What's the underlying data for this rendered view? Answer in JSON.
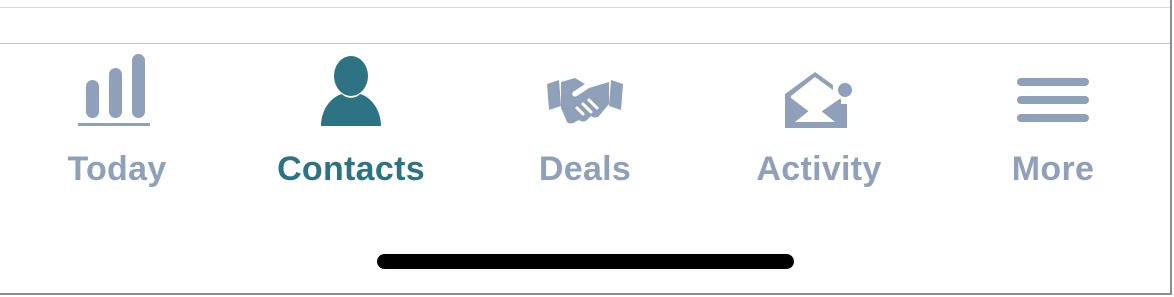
{
  "tabs": [
    {
      "label": "Today",
      "icon": "bar-chart-icon",
      "active": false
    },
    {
      "label": "Contacts",
      "icon": "person-icon",
      "active": true
    },
    {
      "label": "Deals",
      "icon": "handshake-icon",
      "active": false
    },
    {
      "label": "Activity",
      "icon": "envelope-icon",
      "active": false
    },
    {
      "label": "More",
      "icon": "hamburger-menu-icon",
      "active": false
    }
  ],
  "colors": {
    "inactive": "#8fa0bb",
    "active": "#2e7384",
    "home_indicator": "#000000"
  }
}
